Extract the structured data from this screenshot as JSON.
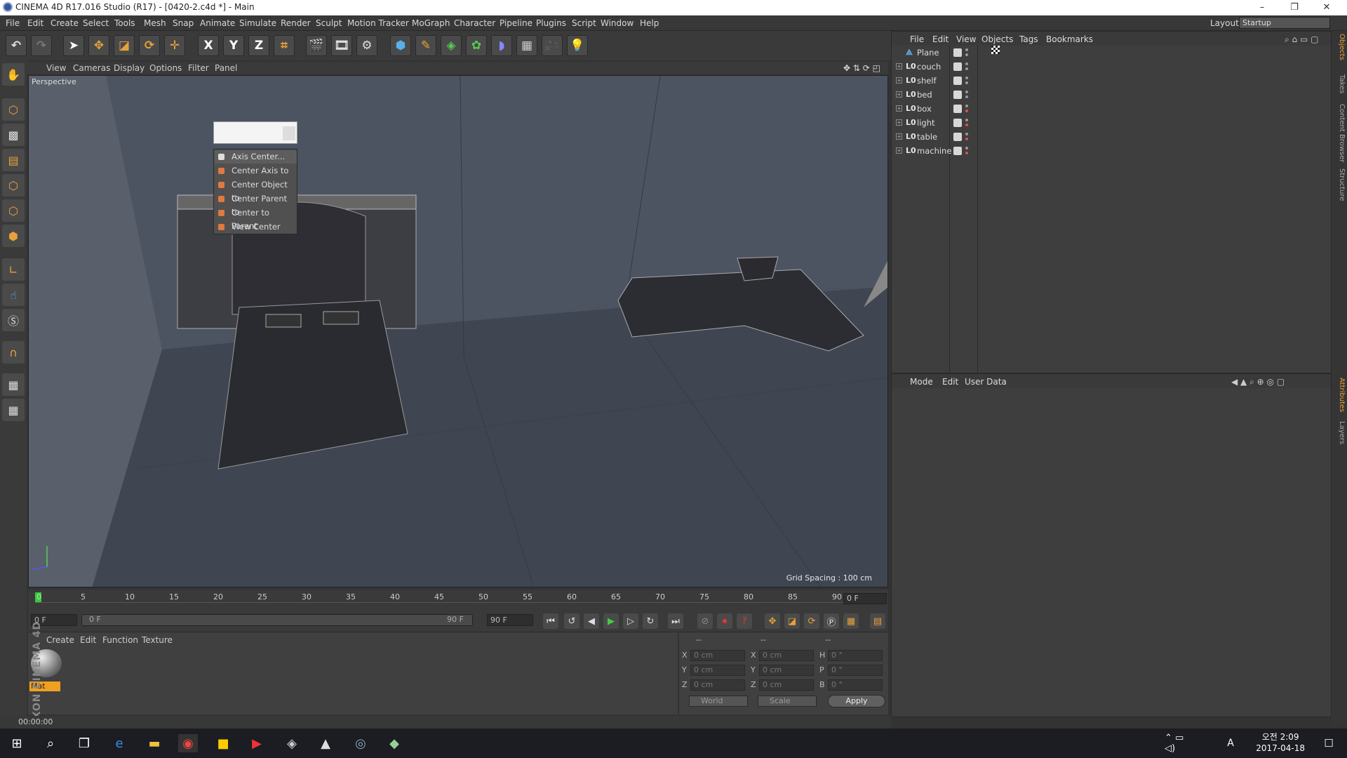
{
  "window": {
    "title": "CINEMA 4D R17.016 Studio (R17) - [0420-2.c4d *] - Main",
    "minimize": "–",
    "maximize": "❐",
    "close": "✕"
  },
  "menubar": {
    "items": [
      "File",
      "Edit",
      "Create",
      "Select",
      "Tools",
      "Mesh",
      "Snap",
      "Animate",
      "Simulate",
      "Render",
      "Sculpt",
      "Motion Tracker",
      "MoGraph",
      "Character",
      "Pipeline",
      "Plugins",
      "Script",
      "Window",
      "Help"
    ],
    "layout_label": "Layout:",
    "layout_value": "Startup"
  },
  "toolbar": {
    "axis_x": "X",
    "axis_y": "Y",
    "axis_z": "Z"
  },
  "viewport": {
    "menu": [
      "View",
      "Cameras",
      "Display",
      "Options",
      "Filter",
      "Panel"
    ],
    "label": "Perspective",
    "grid_spacing": "Grid Spacing : 100 cm"
  },
  "context_menu": {
    "items": [
      "Axis Center...",
      "Center Axis to",
      "Center Object to",
      "Center Parent to",
      "Center to Parent",
      "View Center"
    ]
  },
  "timeline": {
    "ticks": [
      "0",
      "5",
      "10",
      "15",
      "20",
      "25",
      "30",
      "35",
      "40",
      "45",
      "50",
      "55",
      "60",
      "65",
      "70",
      "75",
      "80",
      "85",
      "90"
    ],
    "current_frame": "0 F"
  },
  "transport": {
    "start": "0 F",
    "range_start": "0 F",
    "range_end": "90 F",
    "end": "90 F"
  },
  "material_manager": {
    "menu": [
      "Create",
      "Edit",
      "Function",
      "Texture"
    ],
    "material_name": "Mat"
  },
  "coordinates": {
    "headers": [
      "--",
      "--",
      "--"
    ],
    "rows": [
      {
        "l1": "X",
        "v1": "0 cm",
        "l2": "X",
        "v2": "0 cm",
        "l3": "H",
        "v3": "0 °"
      },
      {
        "l1": "Y",
        "v1": "0 cm",
        "l2": "Y",
        "v2": "0 cm",
        "l3": "P",
        "v3": "0 °"
      },
      {
        "l1": "Z",
        "v1": "0 cm",
        "l2": "Z",
        "v2": "0 cm",
        "l3": "B",
        "v3": "0 °"
      }
    ],
    "space": "World",
    "mode": "Scale",
    "apply": "Apply"
  },
  "status": {
    "time": "00:00:00"
  },
  "branding": {
    "logo": "MAXON CINEMA 4D"
  },
  "object_manager": {
    "menu": [
      "File",
      "Edit",
      "View",
      "Objects",
      "Tags",
      "Bookmarks"
    ],
    "objects": [
      {
        "name": "Plane",
        "type": "plane",
        "red": false
      },
      {
        "name": "couch",
        "type": "null",
        "red": false
      },
      {
        "name": "shelf",
        "type": "null",
        "red": false
      },
      {
        "name": "bed",
        "type": "null",
        "red": false
      },
      {
        "name": "box",
        "type": "null",
        "red": true
      },
      {
        "name": "light",
        "type": "null",
        "red": true
      },
      {
        "name": "table",
        "type": "null",
        "red": true
      },
      {
        "name": "machine",
        "type": "null",
        "red": true
      }
    ],
    "null_icon": "L0"
  },
  "attribute_manager": {
    "menu": [
      "Mode",
      "Edit",
      "User Data"
    ]
  },
  "side_tabs": [
    "Objects",
    "Takes",
    "Content Browser",
    "Structure",
    "Attributes",
    "Layers"
  ],
  "taskbar": {
    "time": "오전 2:09",
    "date": "2017-04-18",
    "ime": "A"
  },
  "colors": {
    "accent": "#e8a13a",
    "viewport_bg": "#4b5260",
    "panel_bg": "#3e3e3e"
  }
}
